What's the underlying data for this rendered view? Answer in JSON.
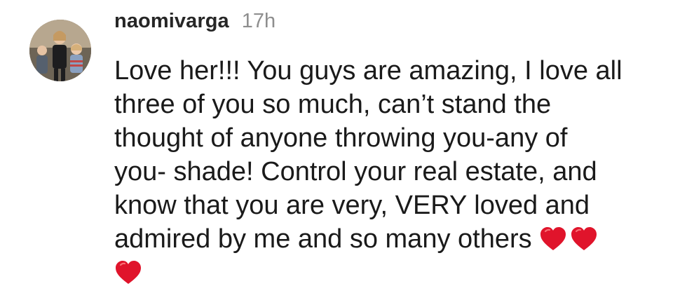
{
  "comment": {
    "username": "naomivarga",
    "timestamp": "17h",
    "text": "Love her!!! You guys are amazing, I love all three of you so much, can’t stand the thought of anyone throwing you-any of you- shade! Control your real estate, and know that you are very, VERY loved and admired by me and so many others",
    "emoji": [
      "red-heart",
      "red-heart",
      "red-heart"
    ],
    "heart_color": "#e0142b"
  }
}
